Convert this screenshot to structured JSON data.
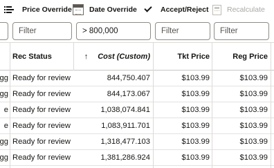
{
  "toolbar": {
    "price_override": "Price Override",
    "date_override": "Date Override",
    "accept_reject": "Accept/Reject",
    "recalculate": "Recalculate"
  },
  "filters": {
    "col0_value": "",
    "rec_status_placeholder": "Filter",
    "cost_value": "> 800,000",
    "tkt_price_placeholder": "Filter",
    "reg_price_placeholder": "Filter"
  },
  "columns": {
    "rec_status": "Rec Status",
    "cost": "Cost (Custom)",
    "cost_sort_arrow": "↑",
    "tkt_price": "Tkt Price",
    "reg_price": "Reg Price"
  },
  "rows": [
    {
      "col0": "ogg",
      "rec_status": "Ready for review",
      "cost": "844,750.407",
      "tkt_price": "$103.99",
      "reg_price": "$103.99"
    },
    {
      "col0": "ogg",
      "rec_status": "Ready for review",
      "cost": "844,173.067",
      "tkt_price": "$103.99",
      "reg_price": "$103.99"
    },
    {
      "col0": "e",
      "rec_status": "Ready for review",
      "cost": "1,038,074.841",
      "tkt_price": "$103.99",
      "reg_price": "$103.99"
    },
    {
      "col0": "e",
      "rec_status": "Ready for review",
      "cost": "1,083,911.701",
      "tkt_price": "$103.99",
      "reg_price": "$103.99"
    },
    {
      "col0": "ogg",
      "rec_status": "Ready for review",
      "cost": "1,318,477.103",
      "tkt_price": "$103.99",
      "reg_price": "$103.99"
    },
    {
      "col0": "ogg",
      "rec_status": "Ready for review",
      "cost": "1,381,286.924",
      "tkt_price": "$103.99",
      "reg_price": "$103.99"
    }
  ]
}
